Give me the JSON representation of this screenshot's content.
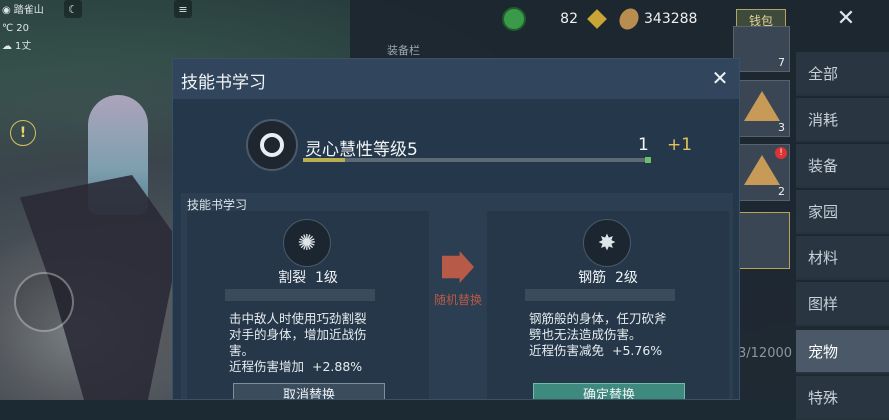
{
  "hud": {
    "location": "踏雀山",
    "temperature": "20",
    "people": "1丈"
  },
  "topbar": {
    "gem_count": "82",
    "coin_count": "343288",
    "wallet_label": "钱包"
  },
  "inventory": {
    "equip_label": "装备栏",
    "slots": [
      {
        "count": "7"
      },
      {
        "count": "3"
      },
      {
        "count": "2"
      }
    ],
    "capacity": "3/12000",
    "categories": [
      {
        "label": "全部",
        "active": false
      },
      {
        "label": "消耗",
        "active": false
      },
      {
        "label": "装备",
        "active": false
      },
      {
        "label": "家园",
        "active": false
      },
      {
        "label": "材料",
        "active": false
      },
      {
        "label": "图样",
        "active": false
      },
      {
        "label": "宠物",
        "active": true
      },
      {
        "label": "特殊",
        "active": false
      }
    ]
  },
  "modal": {
    "title": "技能书学习",
    "skill": {
      "name": "灵心慧性等级5",
      "level": "1",
      "increment": "+1",
      "progress": 0.12
    },
    "section_title": "技能书学习",
    "left_card": {
      "name": "割裂",
      "level": "1级",
      "desc_lines": [
        "击中敌人时使用巧劲割裂",
        "对手的身体，增加近战伤",
        "害。"
      ],
      "bonus_label": "近程伤害增加",
      "bonus_value": "+2.88%",
      "button_label": "取消替换"
    },
    "swap_label": "随机替换",
    "right_card": {
      "name": "钢筋",
      "level": "2级",
      "desc_lines": [
        "钢筋般的身体，任刀砍斧",
        "劈也无法造成伤害。"
      ],
      "bonus_label": "近程伤害减免",
      "bonus_value": "+5.76%",
      "button_label": "确定替换"
    }
  }
}
